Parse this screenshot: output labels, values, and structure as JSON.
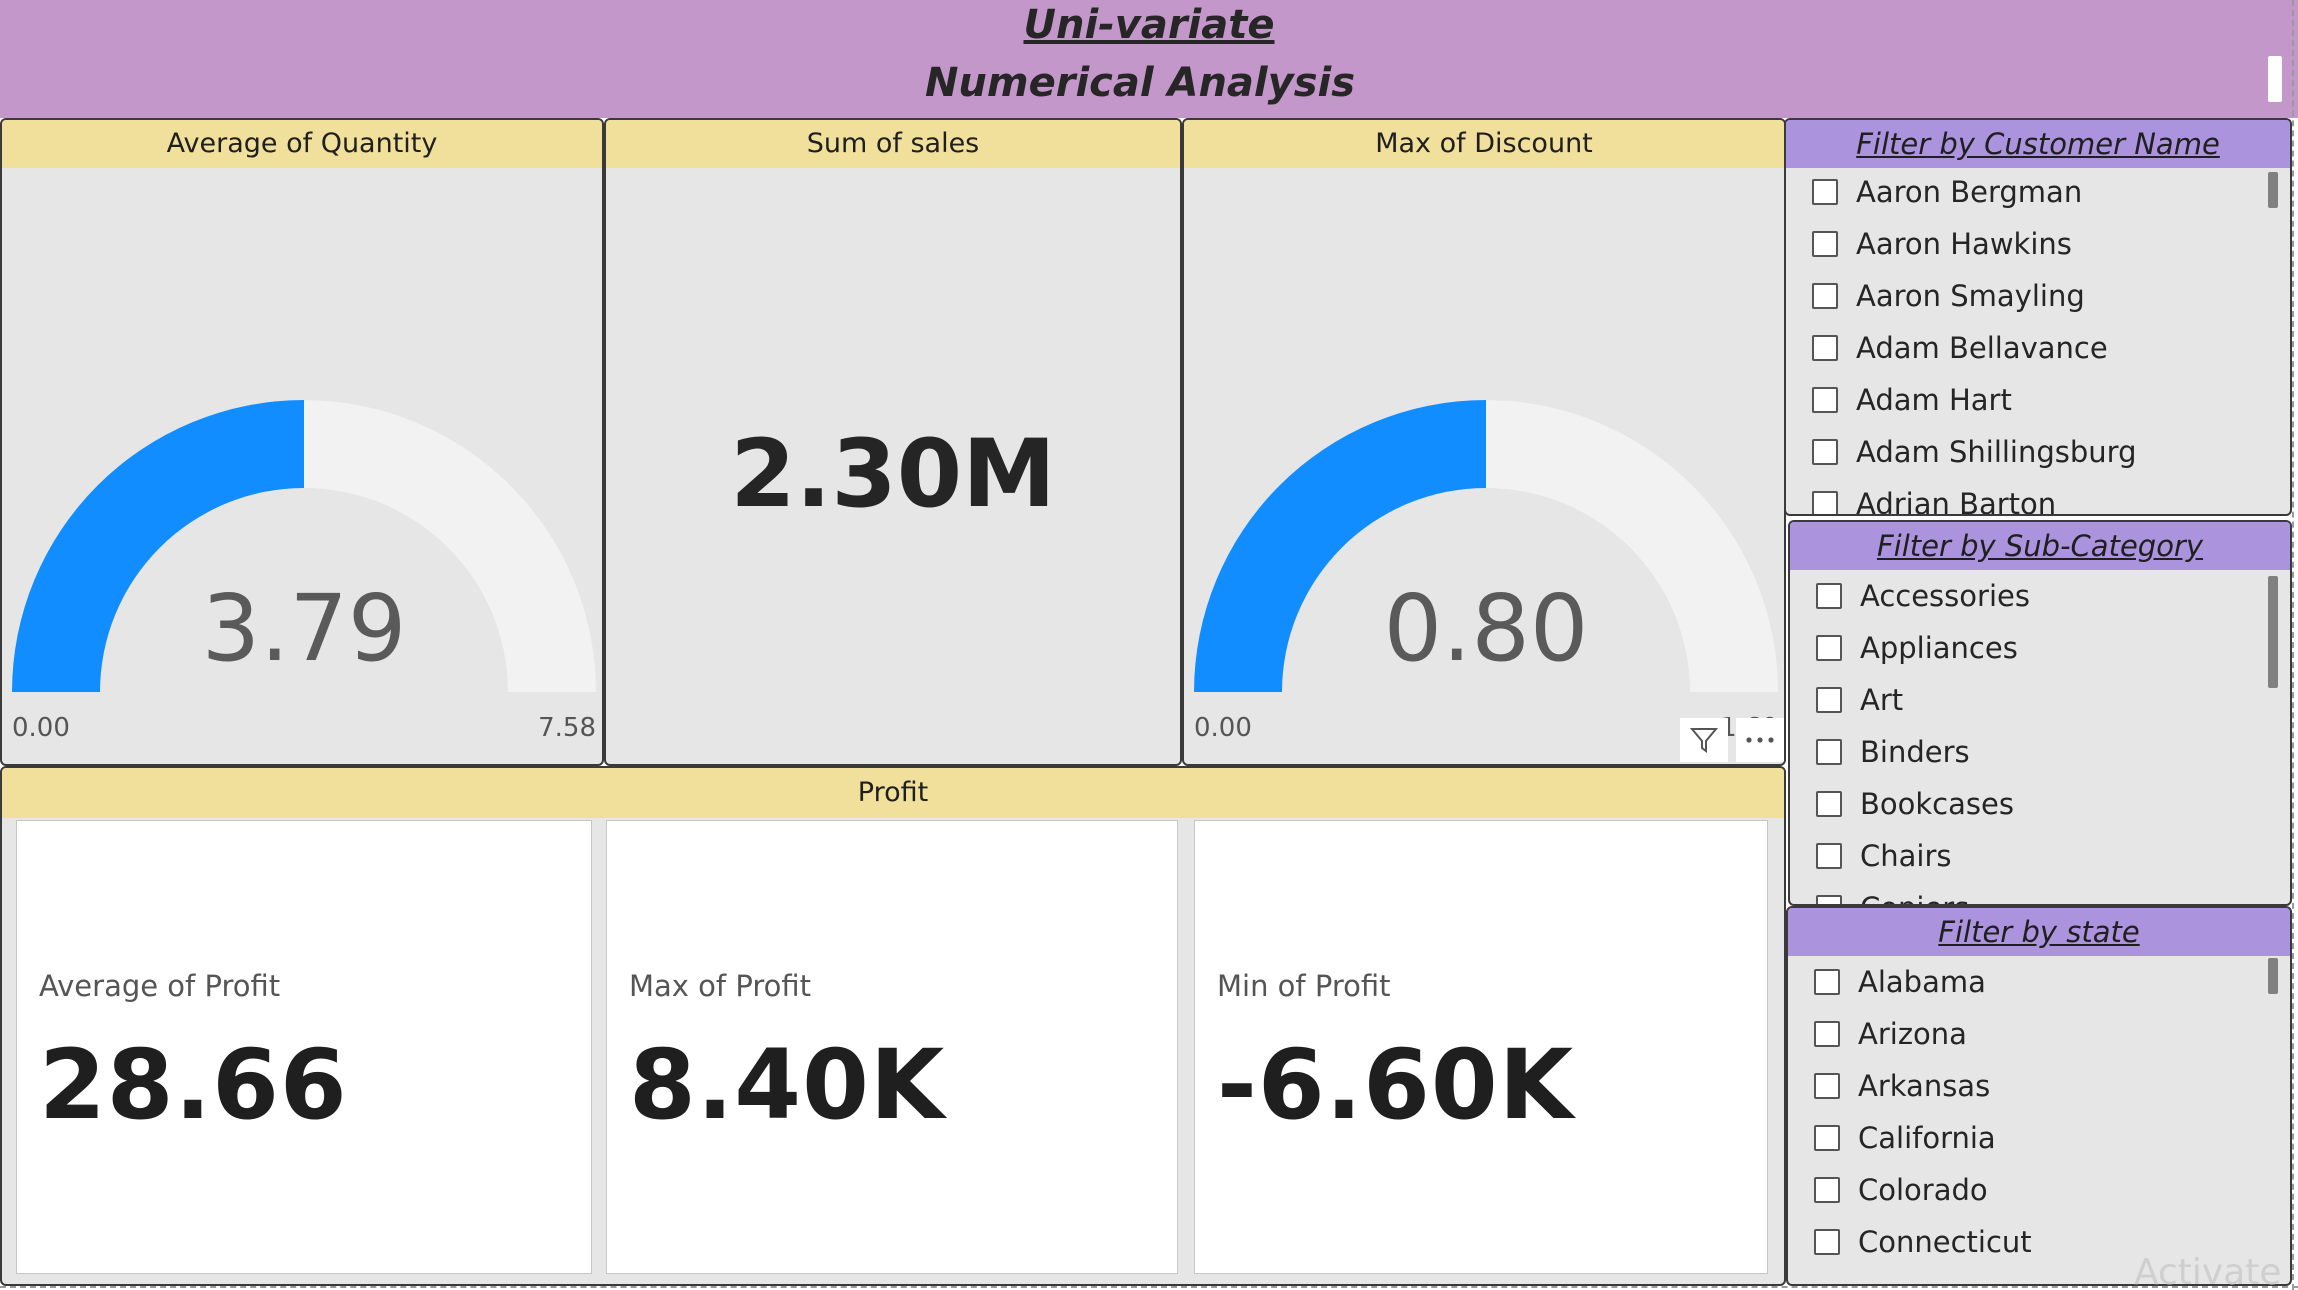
{
  "header": {
    "title_line1": "Uni-variate",
    "title_line2": "Numerical Analysis"
  },
  "gauges": {
    "avg_quantity": {
      "title": "Average of Quantity",
      "value_label": "3.79",
      "value": 3.79,
      "min_label": "0.00",
      "max_label": "7.58",
      "min": 0,
      "max": 7.58
    },
    "max_discount": {
      "title": "Max of Discount",
      "value_label": "0.80",
      "value": 0.8,
      "min_label": "0.00",
      "max_label": "1.60",
      "min": 0,
      "max": 1.6
    }
  },
  "sales_card": {
    "title": "Sum of sales",
    "value": "2.30M"
  },
  "profit": {
    "title": "Profit",
    "cards": [
      {
        "label": "Average of Profit",
        "value": "28.66"
      },
      {
        "label": "Max of Profit",
        "value": "8.40K"
      },
      {
        "label": "Min of Profit",
        "value": "-6.60K"
      }
    ]
  },
  "visual_header_icons": [
    "filter-icon",
    "more-options-icon"
  ],
  "slicers": {
    "customer": {
      "title": "Filter by Customer Name",
      "items": [
        "Aaron Bergman",
        "Aaron Hawkins",
        "Aaron Smayling",
        "Adam Bellavance",
        "Adam Hart",
        "Adam Shillingsburg",
        "Adrian Barton"
      ]
    },
    "subcategory": {
      "title": "Filter by Sub-Category",
      "items": [
        "Accessories",
        "Appliances",
        "Art",
        "Binders",
        "Bookcases",
        "Chairs",
        "Copiers"
      ]
    },
    "state": {
      "title": "Filter by state",
      "items": [
        "Alabama",
        "Arizona",
        "Arkansas",
        "California",
        "Colorado",
        "Connecticut"
      ]
    }
  },
  "watermark": "Activate",
  "colors": {
    "header_bg": "#c497ca",
    "card_header_bg": "#f0e09b",
    "slicer_header_bg": "#ac93dd",
    "gauge_fill": "#118dff",
    "gauge_track": "#f2f2f2"
  }
}
